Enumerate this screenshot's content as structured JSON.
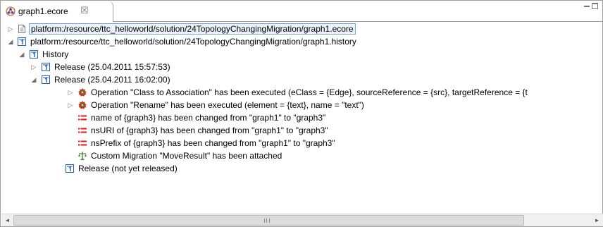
{
  "tab": {
    "title": "graph1.ecore",
    "close_glyph": "☒",
    "icon": "ecore-file-icon"
  },
  "tree": {
    "rows": [
      {
        "label": "platform:/resource/ttc_helloworld/solution/24TopologyChangingMigration/graph1.ecore",
        "icon": "file-icon",
        "expanded": false,
        "selected": true
      },
      {
        "label": "platform:/resource/ttc_helloworld/solution/24TopologyChangingMigration/graph1.history",
        "icon": "history-resource-icon",
        "expanded": true
      },
      {
        "label": "History",
        "icon": "history-icon",
        "expanded": true
      },
      {
        "label": "Release (25.04.2011 15:57:53)",
        "icon": "release-icon",
        "expanded": false
      },
      {
        "label": "Release (25.04.2011 16:02:00)",
        "icon": "release-icon",
        "expanded": true
      },
      {
        "label": "Operation \"Class to Association\" has been executed (eClass = {Edge}, sourceReference = {src}, targetReference = {t",
        "icon": "operation-icon",
        "expanded": false
      },
      {
        "label": "Operation \"Rename\" has been executed (element = {text}, name = \"text\")",
        "icon": "operation-icon",
        "expanded": false
      },
      {
        "label": "name of {graph3} has been changed from \"graph1\" to \"graph3\"",
        "icon": "change-icon"
      },
      {
        "label": "nsURI of {graph3} has been changed from \"graph1\" to \"graph3\"",
        "icon": "change-icon"
      },
      {
        "label": "nsPrefix of {graph3} has been changed from \"graph1\" to \"graph3\"",
        "icon": "change-icon"
      },
      {
        "label": "Custom Migration \"MoveResult\" has been attached",
        "icon": "custom-migration-icon"
      },
      {
        "label": "Release (not yet released)",
        "icon": "release-icon"
      }
    ]
  },
  "scrollbar": {
    "left_glyph": "◄",
    "right_glyph": "►"
  },
  "colors": {
    "selection_border": "#7da2ce",
    "selection_fill": "#eaf2fb",
    "history_icon_blue": "#1f5fbf",
    "operation_red": "#d03020",
    "operation_green": "#3a9a2a",
    "change_red": "#d81b1b",
    "custom_green": "#3a8a2a"
  }
}
